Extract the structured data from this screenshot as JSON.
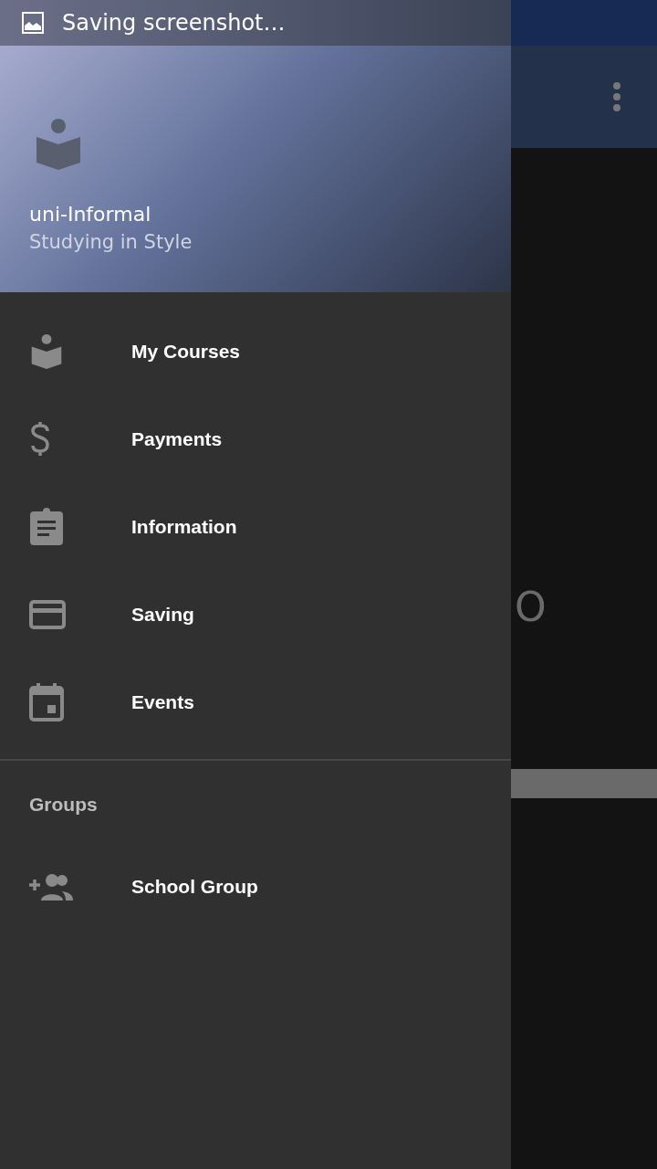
{
  "notification": {
    "text": "Saving screenshot…"
  },
  "background": {
    "partial_text": "O"
  },
  "drawer": {
    "header": {
      "title": "uni-Informal",
      "subtitle": "Studying in Style"
    },
    "items": [
      {
        "kind": "courses",
        "label": "My Courses"
      },
      {
        "kind": "payments",
        "label": "Payments"
      },
      {
        "kind": "information",
        "label": "Information"
      },
      {
        "kind": "saving",
        "label": "Saving"
      },
      {
        "kind": "events",
        "label": "Events"
      }
    ],
    "section": {
      "title": "Groups",
      "items": [
        {
          "kind": "group-add",
          "label": "School Group"
        }
      ]
    }
  }
}
